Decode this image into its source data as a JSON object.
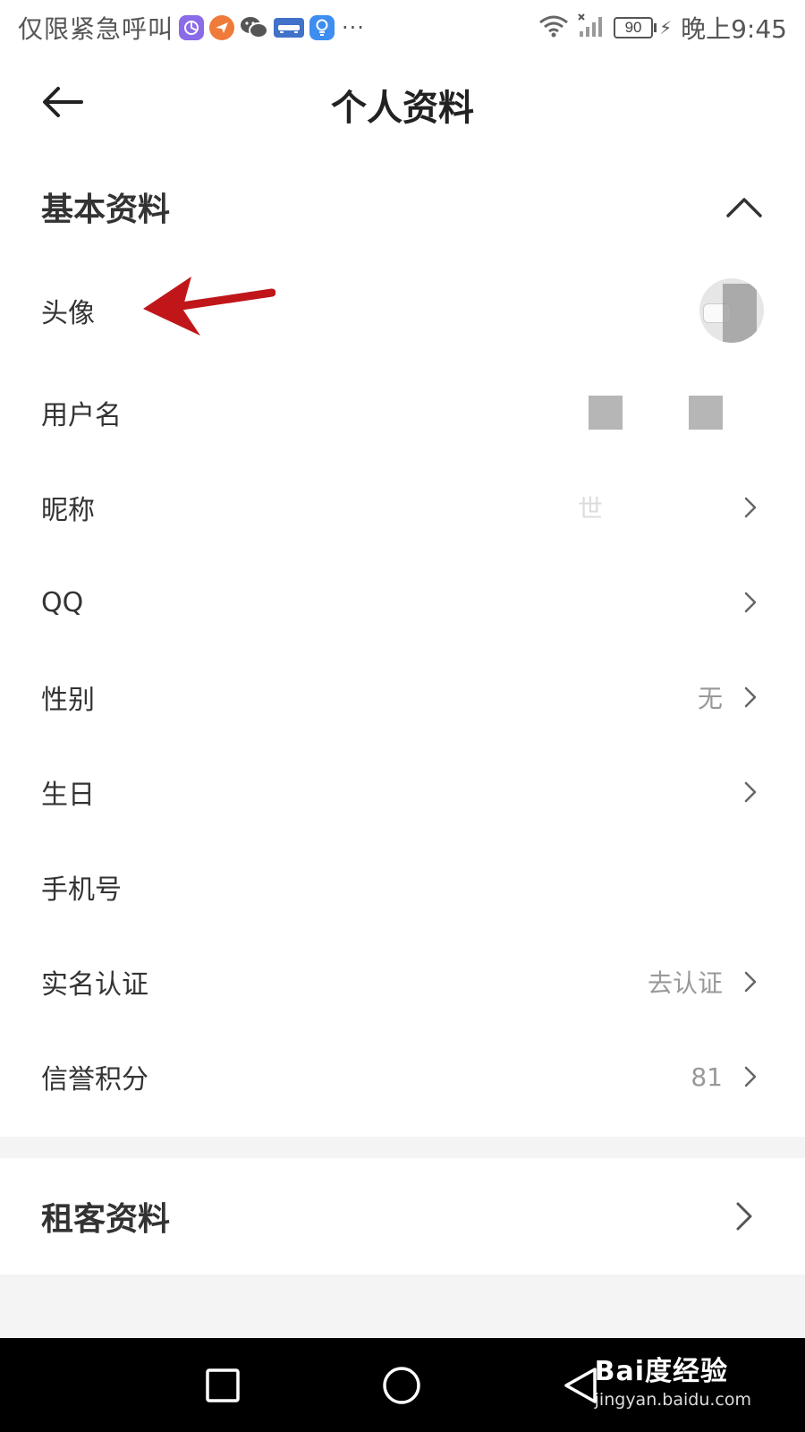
{
  "status_bar": {
    "carrier_text": "仅限紧急呼叫",
    "app_icons": [
      "purple-app-icon",
      "orange-paper-plane-icon",
      "wechat-icon",
      "car-app-icon",
      "bulb-app-icon"
    ],
    "more": "···",
    "battery": "90",
    "time": "晚上9:45"
  },
  "header": {
    "title": "个人资料"
  },
  "basic_section": {
    "title": "基本资料",
    "rows": [
      {
        "label": "头像",
        "value": "",
        "chevron": false
      },
      {
        "label": "用户名",
        "value": "",
        "chevron": false
      },
      {
        "label": "昵称",
        "value": "世",
        "chevron": true
      },
      {
        "label": "QQ",
        "value": "",
        "chevron": true
      },
      {
        "label": "性别",
        "value": "无",
        "chevron": true
      },
      {
        "label": "生日",
        "value": "",
        "chevron": true
      },
      {
        "label": "手机号",
        "value": "",
        "chevron": false
      },
      {
        "label": "实名认证",
        "value": "去认证",
        "chevron": true
      },
      {
        "label": "信誉积分",
        "value": "81",
        "chevron": true
      }
    ]
  },
  "tenant_section": {
    "title": "租客资料"
  },
  "watermark": {
    "main": "Bai度经验",
    "sub": "jingyan.baidu.com"
  },
  "colors": {
    "annotation_arrow": "#c0161a",
    "background": "#f4f4f4"
  }
}
